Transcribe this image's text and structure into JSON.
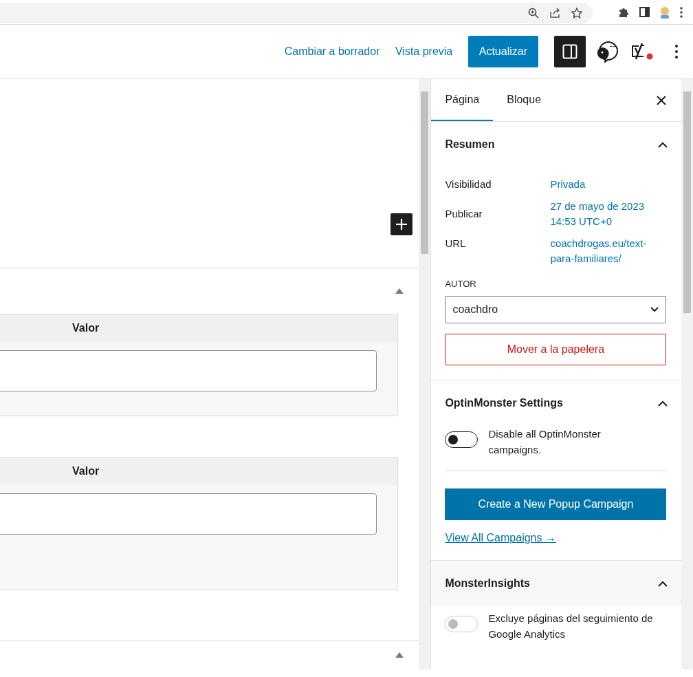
{
  "header": {
    "links": [
      "Cambiar a borrador",
      "Vista previa"
    ],
    "primary_button": "Actualizar",
    "settings_toggle_on": true,
    "notification_dot": true
  },
  "editor": {
    "meta_tables": [
      {
        "column": "Valor"
      },
      {
        "column": "Valor"
      }
    ]
  },
  "sidebar": {
    "tabs": [
      {
        "label": "Página",
        "selected": true
      },
      {
        "label": "Bloque",
        "selected": false
      }
    ],
    "summary": {
      "title": "Resumen",
      "expanded": true,
      "rows": [
        {
          "label": "Visibilidad",
          "value": "Privada"
        },
        {
          "label": "Publicar",
          "value": "27 de mayo de 2023 14:53 UTC+0"
        },
        {
          "label": "URL",
          "value": "coachdrogas.eu/text-para-familiares/"
        }
      ],
      "author_label": "AUTOR",
      "author": "coachdro",
      "trash_button": "Mover a la papelera"
    },
    "optinmonster": {
      "title": "OptinMonster Settings",
      "expanded": true,
      "toggle": {
        "label": "Disable all OptinMonster campaigns.",
        "on": false,
        "disabled": false
      },
      "button": "Create a New Popup Campaign",
      "link": "View All Campaigns →"
    },
    "monsterinsights": {
      "title": "MonsterInsights",
      "expanded": true,
      "toggle": {
        "label": "Excluye páginas del seguimiento de Google Analytics",
        "on": false,
        "disabled": true
      }
    }
  }
}
